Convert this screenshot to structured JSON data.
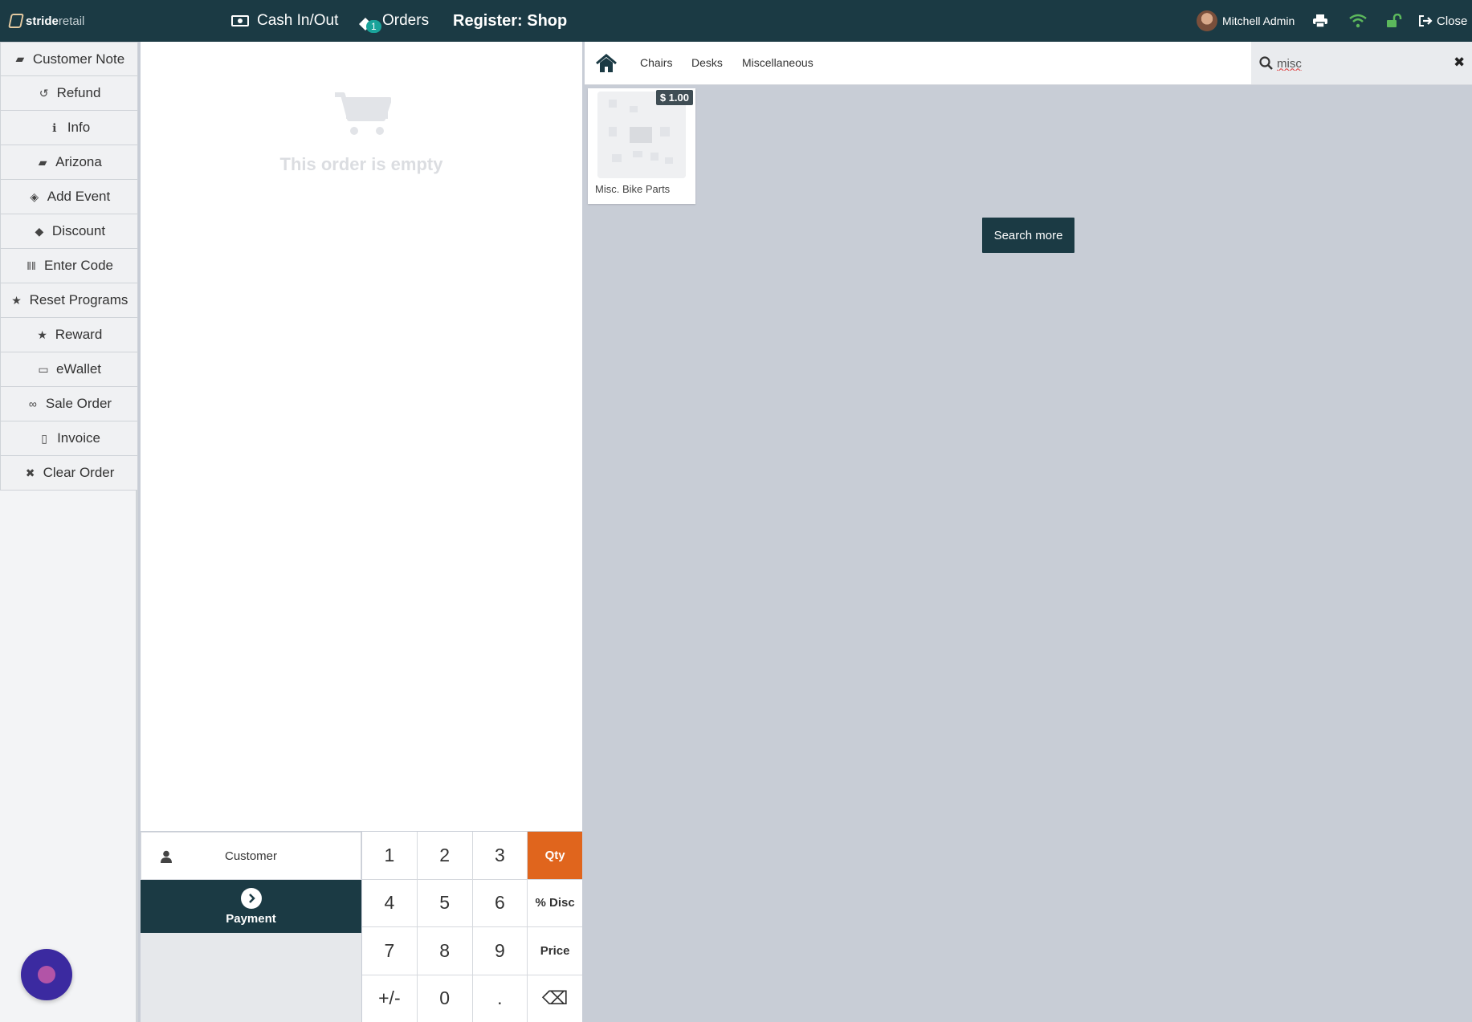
{
  "brand": {
    "name_bold": "stride",
    "name_light": "retail"
  },
  "topbar": {
    "cash_label": "Cash In/Out",
    "orders_label": "Orders",
    "orders_badge": "1",
    "register_title": "Register: Shop",
    "user_name": "Mitchell Admin",
    "close_label": "Close"
  },
  "controls": [
    {
      "label": "Customer Note",
      "icon": "note-icon",
      "glyph": "▰"
    },
    {
      "label": "Refund",
      "icon": "undo-icon",
      "glyph": "↺"
    },
    {
      "label": "Info",
      "icon": "info-icon",
      "glyph": "ℹ"
    },
    {
      "label": "Arizona",
      "icon": "book-icon",
      "glyph": "▰"
    },
    {
      "label": "Add Event",
      "icon": "ticket-icon",
      "glyph": "◈"
    },
    {
      "label": "Discount",
      "icon": "tag-icon",
      "glyph": "◆"
    },
    {
      "label": "Enter Code",
      "icon": "barcode-icon",
      "glyph": "‖‖"
    },
    {
      "label": "Reset Programs",
      "icon": "star-icon",
      "glyph": "★"
    },
    {
      "label": "Reward",
      "icon": "star-icon",
      "glyph": "★"
    },
    {
      "label": "eWallet",
      "icon": "credit-card-icon",
      "glyph": "▭"
    },
    {
      "label": "Sale Order",
      "icon": "link-icon",
      "glyph": "∞"
    },
    {
      "label": "Invoice",
      "icon": "file-pdf-icon",
      "glyph": "▯"
    },
    {
      "label": "Clear Order",
      "icon": "times-icon",
      "glyph": "✖"
    }
  ],
  "order": {
    "empty_message": "This order is empty"
  },
  "customer_button": {
    "label": "Customer"
  },
  "payment_button": {
    "label": "Payment"
  },
  "numpad": {
    "keys": [
      "1",
      "2",
      "3",
      "Qty",
      "4",
      "5",
      "6",
      "% Disc",
      "7",
      "8",
      "9",
      "Price",
      "+/-",
      "0",
      ".",
      "⌫"
    ],
    "active_mode": "Qty"
  },
  "categories": [
    "Chairs",
    "Desks",
    "Miscellaneous"
  ],
  "search": {
    "value": "misc"
  },
  "products": [
    {
      "name": "Misc. Bike Parts",
      "price": "$ 1.00"
    }
  ],
  "search_more_label": "Search more",
  "colors": {
    "dark": "#1b3a44",
    "accent": "#e0651d",
    "wifi": "#5cb85c",
    "lock": "#5cb85c"
  }
}
